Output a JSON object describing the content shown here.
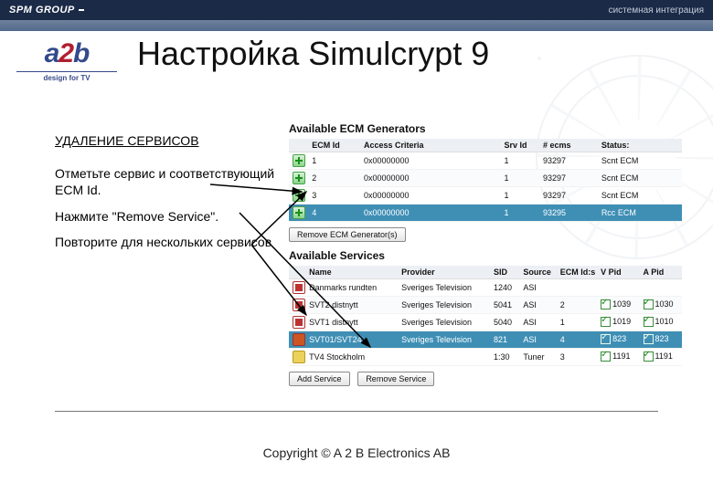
{
  "header": {
    "brand": "SPM GROUP",
    "tagline": "системная интеграция"
  },
  "logo": {
    "a": "a",
    "two": "2",
    "b": "b",
    "tag": "design for TV"
  },
  "title": "Настройка Simulcrypt 9",
  "instructions": {
    "subheading": "УДАЛЕНИЕ СЕРВИСОВ",
    "step1": "Отметьте сервис и соответствующий ECM Id.",
    "step2": "Нажмите \"Remove Service\".",
    "step3": "Повторите для нескольких сервисов"
  },
  "ecm": {
    "title": "Available ECM Generators",
    "headers": [
      "ECM Id",
      "Access Criteria",
      "Srv Id",
      "# ecms",
      "Status:"
    ],
    "rows": [
      {
        "id": "1",
        "ac": "0x00000000",
        "srv": "1",
        "ecms": "93297",
        "status": "Scnt ECM"
      },
      {
        "id": "2",
        "ac": "0x00000000",
        "srv": "1",
        "ecms": "93297",
        "status": "Scnt ECM"
      },
      {
        "id": "3",
        "ac": "0x00000000",
        "srv": "1",
        "ecms": "93297",
        "status": "Scnt ECM"
      },
      {
        "id": "4",
        "ac": "0x00000000",
        "srv": "1",
        "ecms": "93295",
        "status": "Rcc ECM",
        "selected": true
      }
    ],
    "button": "Remove ECM Generator(s)"
  },
  "services": {
    "title": "Available Services",
    "headers": [
      "Name",
      "Provider",
      "SID",
      "Source",
      "ECM Id:s",
      "V Pid",
      "A Pid"
    ],
    "rows": [
      {
        "name": "Danmarks rundten",
        "prov": "Sveriges Television",
        "sid": "1240",
        "src": "ASI",
        "ecm": "",
        "v": "",
        "a": ""
      },
      {
        "name": "SVT2 distnytt",
        "prov": "Sveriges Television",
        "sid": "5041",
        "src": "ASI",
        "ecm": "2",
        "v": "1039",
        "a": "1030"
      },
      {
        "name": "SVT1 distnytt",
        "prov": "Sveriges Television",
        "sid": "5040",
        "src": "ASI",
        "ecm": "1",
        "v": "1019",
        "a": "1010"
      },
      {
        "name": "SVT01/SVT24",
        "prov": "Sveriges Television",
        "sid": "821",
        "src": "ASI",
        "ecm": "4",
        "v": "823",
        "a": "823",
        "selected": true
      },
      {
        "name": "TV4 Stockholm",
        "prov": "",
        "sid": "1:30",
        "src": "Tuner",
        "ecm": "3",
        "v": "1191",
        "a": "1191"
      }
    ],
    "add_button": "Add Service",
    "remove_button": "Remove Service"
  },
  "footer": {
    "copyright": "Copyright © A 2 B Electronics AB"
  }
}
